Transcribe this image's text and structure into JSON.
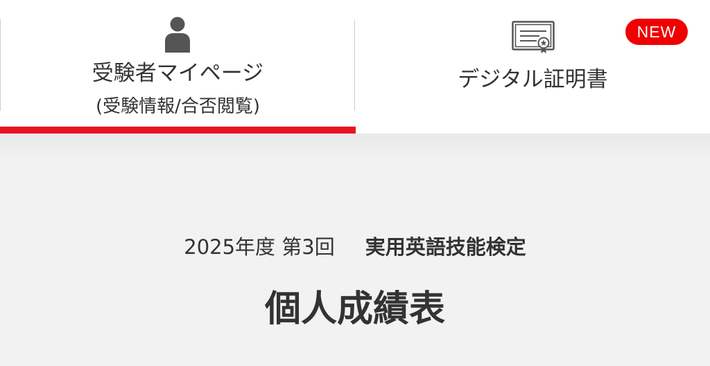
{
  "tabs": {
    "mypage": {
      "icon": "person-icon",
      "label": "受験者マイページ",
      "sublabel": "(受験情報/合否閲覧)",
      "active": true
    },
    "certificate": {
      "icon": "certificate-icon",
      "label": "デジタル証明書",
      "badge": "NEW"
    }
  },
  "exam": {
    "year_round": "2025年度 第3回",
    "name": "実用英語技能検定"
  },
  "page": {
    "title": "個人成績表"
  },
  "colors": {
    "accent_red": "#e8141e",
    "badge_red": "#f00000",
    "icon_gray": "#555555",
    "text": "#333333"
  }
}
